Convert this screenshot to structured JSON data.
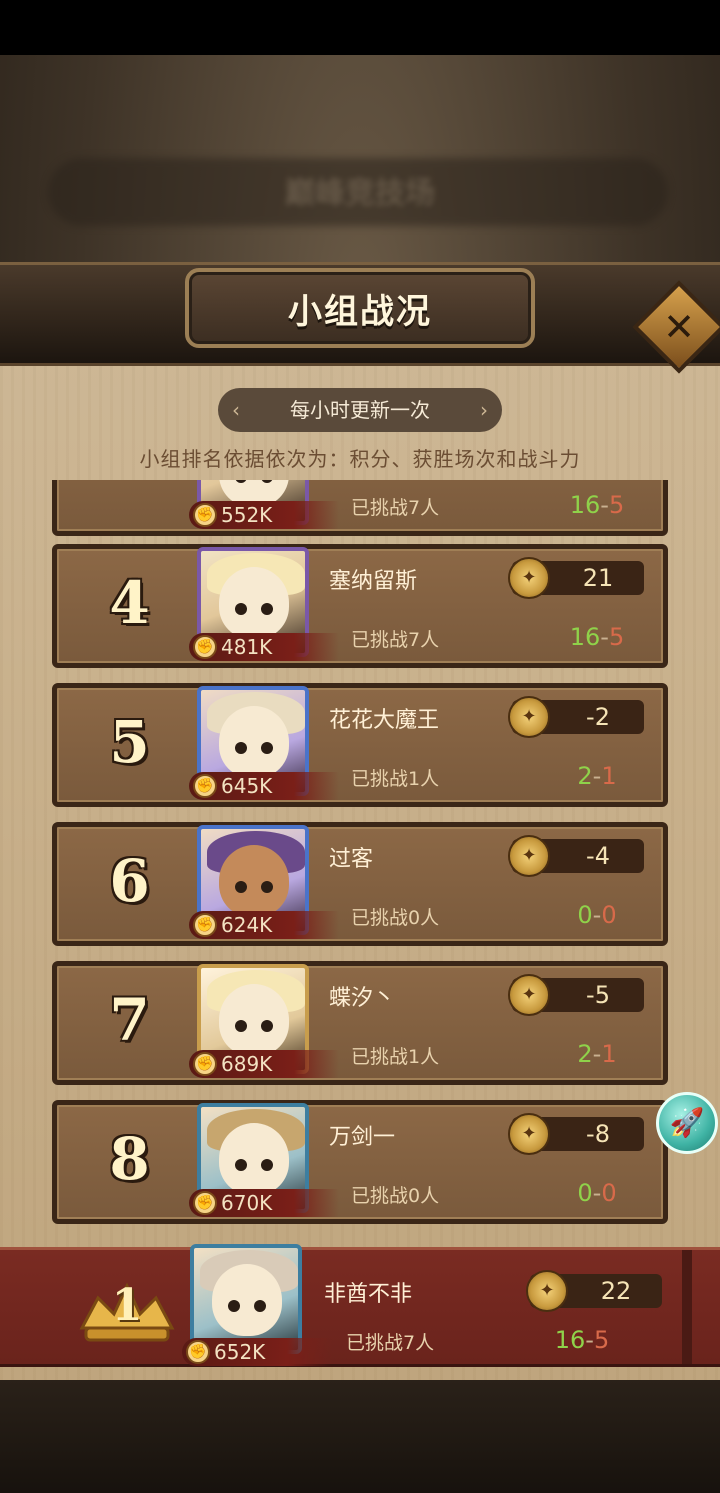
{
  "header": {
    "background_title": "巅峰竞技场",
    "title": "小组战况",
    "close_icon": "close-icon"
  },
  "info": {
    "update_text": "每小时更新一次",
    "rule_text": "小组排名依据依次为：积分、获胜场次和战斗力"
  },
  "rows": [
    {
      "rank": "",
      "name": "",
      "power": "552K",
      "challenged": "已挑战7人",
      "score": "",
      "wins": "16",
      "sep": "-",
      "losses": "5"
    },
    {
      "rank": "4",
      "name": "塞纳留斯",
      "power": "481K",
      "challenged": "已挑战7人",
      "score": "21",
      "wins": "16",
      "sep": "-",
      "losses": "5"
    },
    {
      "rank": "5",
      "name": "花花大魔王",
      "power": "645K",
      "challenged": "已挑战1人",
      "score": "-2",
      "wins": "2",
      "sep": "-",
      "losses": "1"
    },
    {
      "rank": "6",
      "name": "过客",
      "power": "624K",
      "challenged": "已挑战0人",
      "score": "-4",
      "wins": "0",
      "sep": "-",
      "losses": "0"
    },
    {
      "rank": "7",
      "name": "蝶汐丶",
      "power": "689K",
      "challenged": "已挑战1人",
      "score": "-5",
      "wins": "2",
      "sep": "-",
      "losses": "1"
    },
    {
      "rank": "8",
      "name": "万剑一",
      "power": "670K",
      "challenged": "已挑战0人",
      "score": "-8",
      "wins": "0",
      "sep": "-",
      "losses": "0"
    }
  ],
  "mine": {
    "rank": "1",
    "name": "非酋不非",
    "power": "652K",
    "challenged": "已挑战7人",
    "score": "22",
    "wins": "16",
    "sep": "-",
    "losses": "5"
  },
  "colors": {
    "win": "#8fd24a",
    "loss": "#d86a4a",
    "panel": "#c8b08b",
    "mine_row": "#7a2b22"
  },
  "icons": {
    "power": "fist-icon",
    "score": "medal-icon",
    "rocket": "rocket-icon"
  }
}
